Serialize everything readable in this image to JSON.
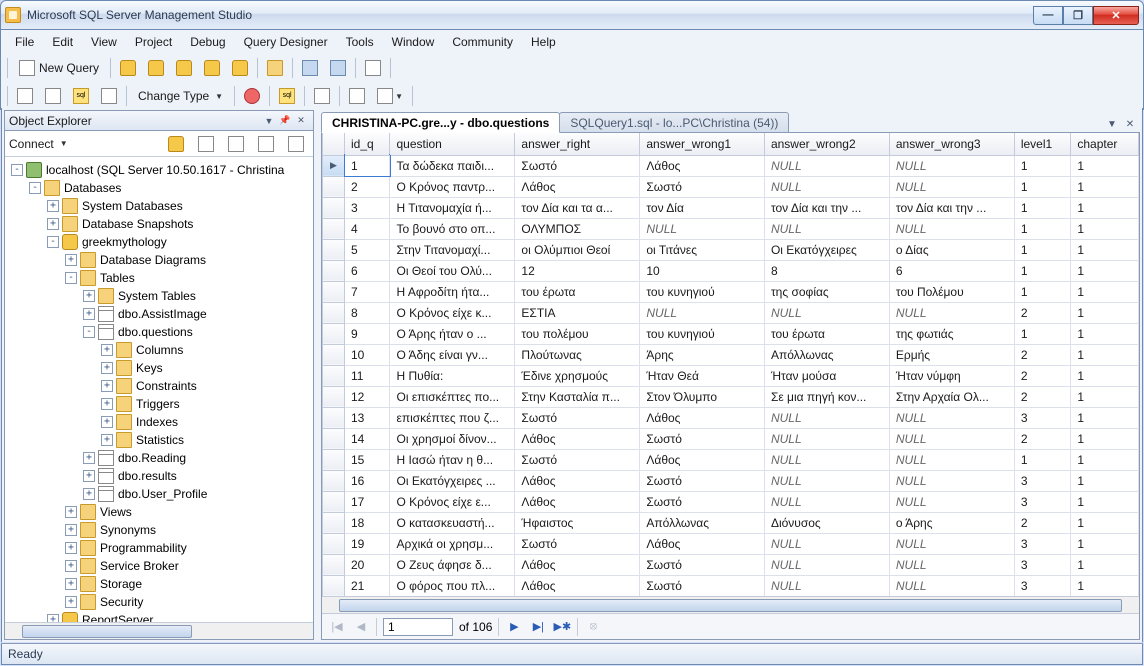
{
  "window": {
    "title": "Microsoft SQL Server Management Studio"
  },
  "menu": [
    "File",
    "Edit",
    "View",
    "Project",
    "Debug",
    "Query Designer",
    "Tools",
    "Window",
    "Community",
    "Help"
  ],
  "toolbar": {
    "new_query": "New Query",
    "change_type": "Change Type"
  },
  "object_explorer": {
    "title": "Object Explorer",
    "connect": "Connect",
    "root": "localhost (SQL Server 10.50.1617 - Christina",
    "databases": "Databases",
    "sysdb": "System Databases",
    "dbsnap": "Database Snapshots",
    "userdb": "greekmythology",
    "dbdiag": "Database Diagrams",
    "tables": "Tables",
    "systables": "System Tables",
    "t_assist": "dbo.AssistImage",
    "t_questions": "dbo.questions",
    "columns": "Columns",
    "keys": "Keys",
    "constraints": "Constraints",
    "triggers": "Triggers",
    "indexes": "Indexes",
    "statistics": "Statistics",
    "t_reading": "dbo.Reading",
    "t_results": "dbo.results",
    "t_userprofile": "dbo.User_Profile",
    "views": "Views",
    "synonyms": "Synonyms",
    "prog": "Programmability",
    "sb": "Service Broker",
    "storage": "Storage",
    "security": "Security",
    "reportserver": "ReportServer"
  },
  "tabs": {
    "active": "CHRISTINA-PC.gre...y - dbo.questions",
    "inactive": "SQLQuery1.sql - lo...PC\\Christina (54))"
  },
  "grid": {
    "columns": [
      "id_q",
      "question",
      "answer_right",
      "answer_wrong1",
      "answer_wrong2",
      "answer_wrong3",
      "level1",
      "chapter"
    ],
    "rows": [
      [
        "1",
        "Τα δώδεκα παιδι...",
        "Σωστό",
        "Λάθος",
        "NULL",
        "NULL",
        "1",
        "1"
      ],
      [
        "2",
        "Ο Κρόνος παντρ...",
        "Λάθος",
        "Σωστό",
        "NULL",
        "NULL",
        "1",
        "1"
      ],
      [
        "3",
        "Η Τιτανομαχία ή...",
        "τον Δία και τα α...",
        "τον Δία",
        "τον Δία και την ...",
        "τον Δία και την ...",
        "1",
        "1"
      ],
      [
        "4",
        "Το βουνό στο οπ...",
        "ΟΛΥΜΠΟΣ",
        "NULL",
        "NULL",
        "NULL",
        "1",
        "1"
      ],
      [
        "5",
        "Στην Τιτανομαχί...",
        "οι Ολύμπιοι Θεοί",
        "οι Τιτάνες",
        "Οι Εκατόγχειρες",
        "ο Δίας",
        "1",
        "1"
      ],
      [
        "6",
        "Οι Θεοί του Ολύ...",
        "12",
        "10",
        "8",
        "6",
        "1",
        "1"
      ],
      [
        "7",
        "Η Αφροδίτη ήτα...",
        "του έρωτα",
        "του κυνηγιού",
        "της σοφίας",
        "του Πολέμου",
        "1",
        "1"
      ],
      [
        "8",
        "Ο Κρόνος είχε κ...",
        "ΕΣΤΙΑ",
        "NULL",
        "NULL",
        "NULL",
        "2",
        "1"
      ],
      [
        "9",
        "Ο Άρης ήταν ο ...",
        "του πολέμου",
        "του κυνηγιού",
        "του έρωτα",
        "της φωτιάς",
        "1",
        "1"
      ],
      [
        "10",
        "Ο Άδης είναι γν...",
        "Πλούτωνας",
        "Άρης",
        "Απόλλωνας",
        "Ερμής",
        "2",
        "1"
      ],
      [
        "11",
        "Η Πυθία:",
        "Έδινε χρησμούς",
        "Ήταν Θεά",
        "Ήταν μούσα",
        "Ήταν νύμφη",
        "2",
        "1"
      ],
      [
        "12",
        "Οι επισκέπτες πο...",
        "Στην Κασταλία π...",
        "Στον Όλυμπο",
        "Σε μια πηγή κον...",
        "Στην Αρχαία Ολ...",
        "2",
        "1"
      ],
      [
        "13",
        "επισκέπτες που ζ...",
        "Σωστό",
        "Λάθος",
        "NULL",
        "NULL",
        "3",
        "1"
      ],
      [
        "14",
        "Οι χρησμοί δίνον...",
        "Λάθος",
        "Σωστό",
        "NULL",
        "NULL",
        "2",
        "1"
      ],
      [
        "15",
        "Η Ιασώ ήταν η θ...",
        "Σωστό",
        "Λάθος",
        "NULL",
        "NULL",
        "1",
        "1"
      ],
      [
        "16",
        "Οι Εκατόγχειρες ...",
        "Λάθος",
        "Σωστό",
        "NULL",
        "NULL",
        "3",
        "1"
      ],
      [
        "17",
        "Ο Κρόνος είχε ε...",
        "Λάθος",
        "Σωστό",
        "NULL",
        "NULL",
        "3",
        "1"
      ],
      [
        "18",
        "Ο κατασκευαστή...",
        "Ήφαιστος",
        "Απόλλωνας",
        "Διόνυσος",
        "ο Άρης",
        "2",
        "1"
      ],
      [
        "19",
        "Αρχικά οι χρησμ...",
        "Σωστό",
        "Λάθος",
        "NULL",
        "NULL",
        "3",
        "1"
      ],
      [
        "20",
        "Ο Ζευς άφησε δ...",
        "Λάθος",
        "Σωστό",
        "NULL",
        "NULL",
        "3",
        "1"
      ],
      [
        "21",
        "Ο φόρος που πλ...",
        "Λάθος",
        "Σωστό",
        "NULL",
        "NULL",
        "3",
        "1"
      ]
    ]
  },
  "nav": {
    "pos": "1",
    "of": "of 106"
  },
  "status": "Ready"
}
